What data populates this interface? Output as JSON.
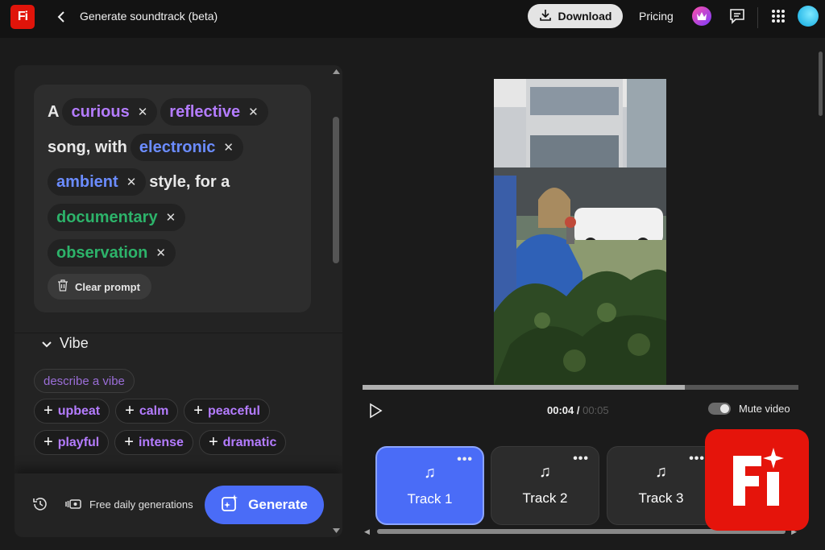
{
  "app": {
    "logo_text": "Fi",
    "title": "Generate soundtrack (beta)"
  },
  "header": {
    "download_label": "Download",
    "pricing_label": "Pricing"
  },
  "prompt": {
    "word_a": "A",
    "chip_1": "curious",
    "chip_2": "reflective",
    "mid_1": "song, with",
    "chip_3": "electronic",
    "chip_4": "ambient",
    "mid_2": "style, for a",
    "chip_5": "documentary",
    "chip_6": "observation",
    "remove_glyph": "✕",
    "clear_label": "Clear prompt"
  },
  "vibe": {
    "heading": "Vibe",
    "placeholder": "describe a vibe",
    "row1": [
      "upbeat",
      "calm",
      "peaceful"
    ],
    "row2": [
      "playful",
      "intense",
      "dramatic"
    ]
  },
  "footer": {
    "free_label": "Free daily generations",
    "generate_label": "Generate"
  },
  "player": {
    "current_time": "00:04",
    "separator": " / ",
    "total_time": "00:05",
    "progress": 0.74,
    "mute_label": "Mute video"
  },
  "tracks": [
    {
      "name": "Track 1",
      "active": true
    },
    {
      "name": "Track 2",
      "active": false
    },
    {
      "name": "Track 3",
      "active": false
    }
  ],
  "colors": {
    "accent_blue": "#4a6cf7",
    "chip_purple": "#b47cff",
    "chip_blue": "#6b8cff",
    "chip_green": "#2db36a",
    "brand_red": "#e5140b"
  },
  "icons": [
    "back-chevron-icon",
    "download-icon",
    "crown-icon",
    "chat-icon",
    "apps-grid-icon",
    "trash-icon",
    "chevron-down-icon",
    "history-icon",
    "credits-icon",
    "generate-sparkle-icon",
    "play-icon",
    "music-note-icon",
    "more-dots-icon"
  ]
}
